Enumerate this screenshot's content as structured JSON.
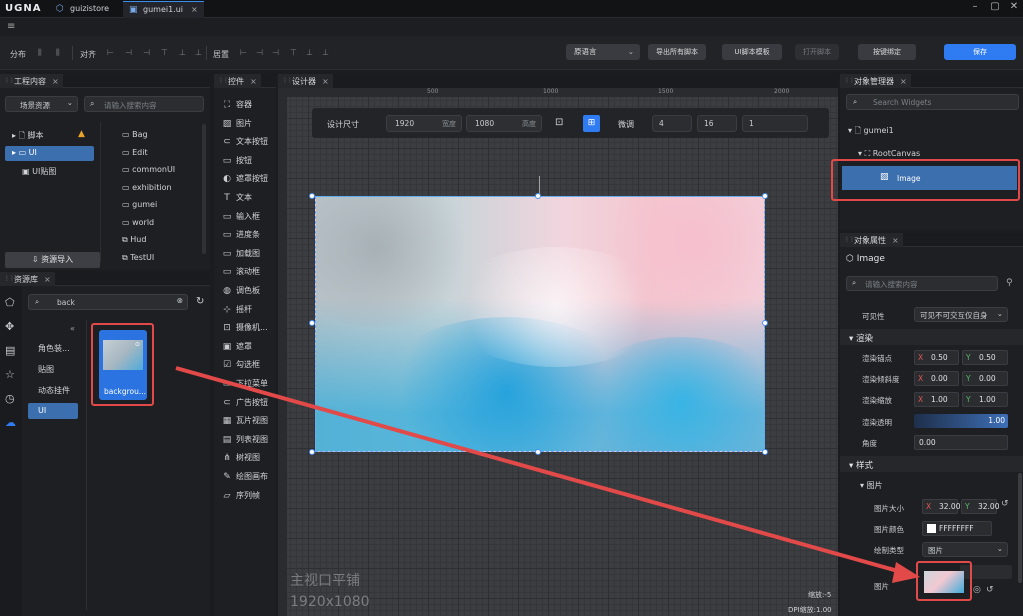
{
  "app": {
    "logo": "UGNA"
  },
  "tabs": [
    {
      "label": "guizistore"
    },
    {
      "label": "gumei1.ui"
    }
  ],
  "menu": {
    "icon": "hamburger-icon"
  },
  "toolbar": {
    "distribute": "分布",
    "align": "对齐",
    "center": "居置",
    "language": "原语言",
    "export_btn": "导出所有脚本",
    "template_btn": "UI脚本模板",
    "open_btn": "打开脚本",
    "bind_btn": "按键绑定",
    "save_btn": "保存"
  },
  "project": {
    "tab": "工程内容",
    "filter": "场景资源",
    "search_placeholder": "请输入搜索内容",
    "tree": [
      {
        "label": "脚本"
      },
      {
        "label": "UI"
      },
      {
        "label": "UI贴图"
      }
    ],
    "folders": [
      "Bag",
      "Edit",
      "commonUI",
      "exhibition",
      "gumei",
      "world",
      "Hud",
      "TestUI"
    ],
    "import_btn": "资源导入"
  },
  "assets": {
    "tab": "资源库",
    "search_value": "back",
    "categories": [
      "角色装...",
      "贴图",
      "动态挂件",
      "UI"
    ],
    "item_label": "backgrou..."
  },
  "controls": {
    "tab": "控件",
    "items": [
      "容器",
      "图片",
      "文本按钮",
      "按钮",
      "遮罩按钮",
      "文本",
      "输入框",
      "进度条",
      "加载图",
      "滚动框",
      "调色板",
      "摇杆",
      "摄像机...",
      "遮罩",
      "勾选框",
      "下拉菜单",
      "广告按钮",
      "瓦片视图",
      "列表视图",
      "树视图",
      "绘图画布",
      "序列帧"
    ]
  },
  "designer": {
    "tab": "设计器",
    "size_label": "设计尺寸",
    "width": "1920",
    "width_label": "宽度",
    "height": "1080",
    "height_label": "高度",
    "fine_label": "微调",
    "fine1": "4",
    "fine2": "16",
    "fine3": "1",
    "ruler": [
      "500",
      "1000",
      "1500",
      "2000"
    ],
    "watermark1": "主视口平铺",
    "watermark2": "1920x1080",
    "zoom": "缩放:-5",
    "dpi": "DPI缩放:1.00"
  },
  "objects": {
    "tab": "对象管理器",
    "search_placeholder": "Search Widgets",
    "root": "gumei1",
    "canvas": "RootCanvas",
    "image": "Image"
  },
  "props": {
    "tab": "对象属性",
    "name": "Image",
    "search_placeholder": "请输入搜索内容",
    "visibility_label": "可见性",
    "visibility_value": "可见不可交互仅自身",
    "render_section": "渲染",
    "anchor_label": "渲染锚点",
    "anchor_x": "0.50",
    "anchor_y": "0.50",
    "skew_label": "渲染倾斜度",
    "skew_x": "0.00",
    "skew_y": "0.00",
    "scale_label": "渲染缩放",
    "scale_x": "1.00",
    "scale_y": "1.00",
    "opacity_label": "渲染透明",
    "opacity_value": "1.00",
    "angle_label": "角度",
    "angle_value": "0.00",
    "style_section": "样式",
    "image_section": "图片",
    "imgsize_label": "图片大小",
    "imgsize_x": "32.00",
    "imgsize_y": "32.00",
    "color_label": "图片颜色",
    "color_value": "FFFFFFFF",
    "drawtype_label": "绘制类型",
    "drawtype_value": "图片",
    "image_label": "图片"
  },
  "colors": {
    "accent": "#2f7bf1",
    "highlight": "#e24949",
    "panel": "#1e1f23"
  }
}
